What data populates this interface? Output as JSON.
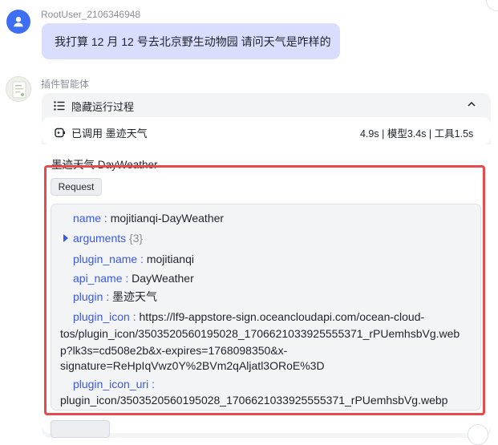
{
  "user": {
    "name": "RootUser_2106346948",
    "message": "我打算 12 月 12 号去北京野生动物园 请问天气是咋样的"
  },
  "bot": {
    "name": "插件智能体",
    "process_toggle_label": "隐藏运行过程",
    "called_label": "已调用 墨迹天气",
    "timing": "4.9s | 模型3.4s | 工具1.5s",
    "tool_title": "墨迹天气 DayWeather",
    "request_label": "Request"
  },
  "request": {
    "name_key": "name",
    "name_val": "mojitianqi-DayWeather",
    "arguments_key": "arguments",
    "arguments_count": "{3}",
    "plugin_name_key": "plugin_name",
    "plugin_name_val": "mojitianqi",
    "api_name_key": "api_name",
    "api_name_val": "DayWeather",
    "plugin_key": "plugin",
    "plugin_val": "墨迹天气",
    "plugin_icon_key": "plugin_icon",
    "plugin_icon_val_1": "https://lf9-appstore-sign.oceancloudapi.com/ocean-cloud-",
    "plugin_icon_val_2": "tos/plugin_icon/3503520560195028_1706621033925555371_rPUemhsbVg.web",
    "plugin_icon_val_3": "p?lk3s=cd508e2b&x-expires=1768098350&x-",
    "plugin_icon_val_4": "signature=ReHpIqVwz0Y%2BVm2qAljatl3ORoE%3D",
    "plugin_icon_uri_key": "plugin_icon_uri",
    "plugin_icon_uri_val": "plugin_icon/3503520560195028_1706621033925555371_rPUemhsbVg.webp"
  },
  "colors": {
    "accent_blue": "#3e6ff2",
    "key_blue": "#3a58e8",
    "highlight_red": "#e74a4c",
    "bubble": "#d9defe"
  }
}
